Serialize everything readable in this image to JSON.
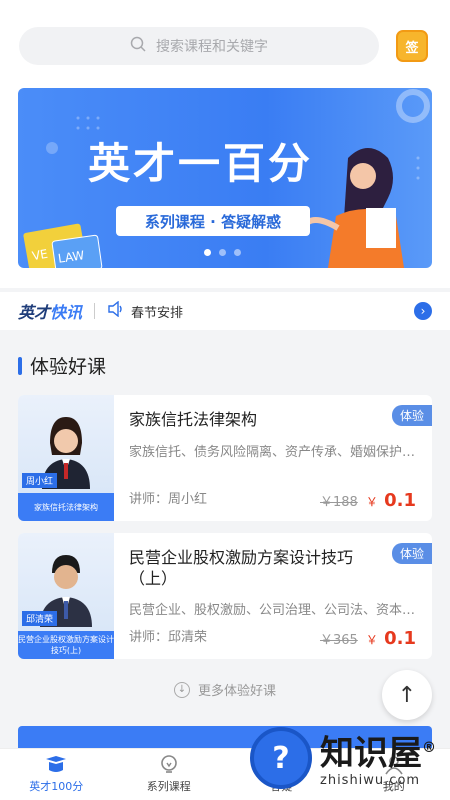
{
  "search": {
    "placeholder": "搜索课程和关键字",
    "sign_label": "签"
  },
  "banner": {
    "title": "英才一百分",
    "subtitle": "系列课程 · 答疑解惑",
    "tag_ve": "VE",
    "tag_law": "LAW"
  },
  "news": {
    "brand_a": "英才",
    "brand_b": "快讯",
    "text": "春节安排"
  },
  "section": {
    "title": "体验好课"
  },
  "courses": [
    {
      "title": "家族信托法律架构",
      "tag": "体验",
      "desc": "家族信托、债务风险隔离、资产传承、婚姻保护…",
      "teacher": "讲师：周小红",
      "old_price": "￥188",
      "currency": "￥",
      "new_price": "0.1",
      "thumb_name": "周小红",
      "thumb_caption": "家族信托法律架构"
    },
    {
      "title": "民营企业股权激励方案设计技巧（上）",
      "tag": "体验",
      "desc": "民营企业、股权激励、公司治理、公司法、资本…",
      "teacher": "讲师：邱清荣",
      "old_price": "￥365",
      "currency": "￥",
      "new_price": "0.1",
      "thumb_name": "邱清荣",
      "thumb_caption": "民营企业股权激励方案设计技巧(上)"
    }
  ],
  "more_label": "更多体验好课",
  "tabs": [
    {
      "label": "英才100分",
      "icon": "book-icon"
    },
    {
      "label": "系列课程",
      "icon": "bulb-icon"
    },
    {
      "label": "答疑",
      "icon": "question-icon"
    },
    {
      "label": "我的",
      "icon": "user-icon"
    }
  ],
  "watermark": {
    "logo": "?",
    "big": "知识屋",
    "small": "zhishiwu.com",
    "mark": "®"
  },
  "colors": {
    "accent": "#2c6ee8",
    "price": "#e6391e",
    "sign": "#f7b52c"
  }
}
